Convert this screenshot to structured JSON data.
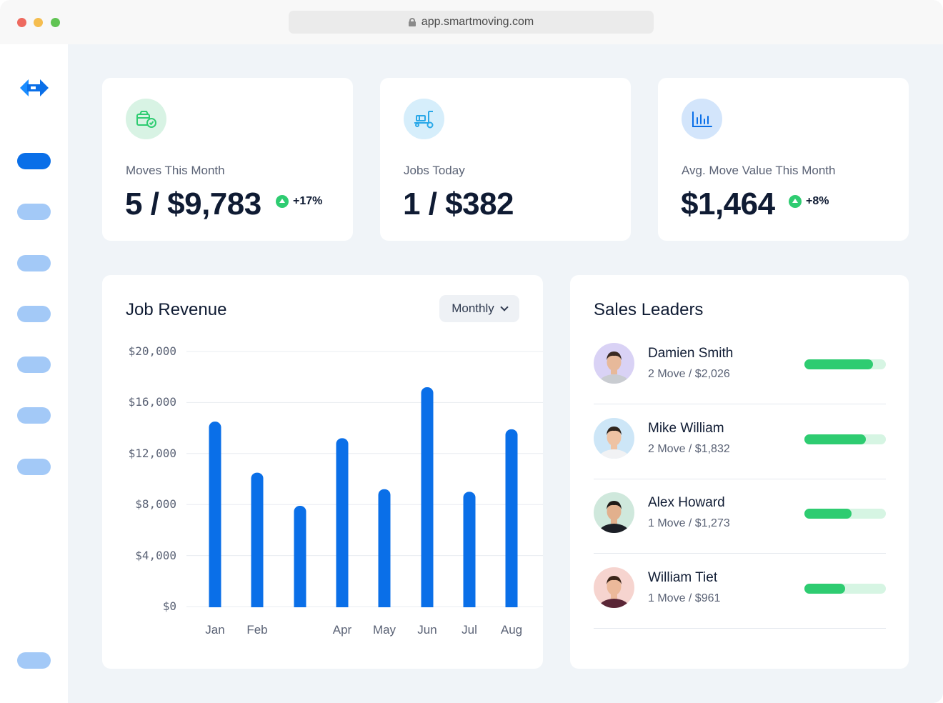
{
  "browser": {
    "url": "app.smartmoving.com"
  },
  "colors": {
    "accent": "#0a6fe8",
    "nav_inactive": "#a3c9f7",
    "success": "#2ecc71",
    "success_track": "#d6f5e3",
    "background": "#f0f4f8"
  },
  "sidebar": {
    "logo": "smartmoving-logo",
    "items": [
      {
        "icon": "nav-item",
        "active": true
      },
      {
        "icon": "nav-item",
        "active": false
      },
      {
        "icon": "nav-item",
        "active": false
      },
      {
        "icon": "nav-item",
        "active": false
      },
      {
        "icon": "nav-item",
        "active": false
      },
      {
        "icon": "nav-item",
        "active": false
      },
      {
        "icon": "nav-item",
        "active": false
      },
      {
        "icon": "nav-item",
        "active": false
      }
    ]
  },
  "stats": [
    {
      "icon": "box-check-icon",
      "label": "Moves This Month",
      "value": "5 / $9,783",
      "delta": "+17%"
    },
    {
      "icon": "dolly-icon",
      "label": "Jobs Today",
      "value": "1 / $382",
      "delta": ""
    },
    {
      "icon": "bar-chart-icon",
      "label": "Avg. Move Value This Month",
      "value": "$1,464",
      "delta": "+8%"
    }
  ],
  "revenue": {
    "title": "Job Revenue",
    "period": "Monthly"
  },
  "chart_data": {
    "type": "bar",
    "title": "Job Revenue",
    "categories": [
      "Jan",
      "Feb",
      "",
      "Apr",
      "May",
      "Jun",
      "Jul",
      "Aug"
    ],
    "values": [
      14500,
      10500,
      7900,
      13200,
      9200,
      17200,
      9000,
      13900
    ],
    "ylim": [
      0,
      20000
    ],
    "yticks": [
      "$20,000",
      "$16,000",
      "$12,000",
      "$8,000",
      "$4,000",
      "$0"
    ],
    "ytick_values": [
      20000,
      16000,
      12000,
      8000,
      4000,
      0
    ],
    "grid": true,
    "color": "#0a6fe8"
  },
  "leaders": {
    "title": "Sales Leaders",
    "items": [
      {
        "name": "Damien Smith",
        "detail": "2 Move / $2,026",
        "progress": 0.84,
        "avatar_bg": "#d9d2f5",
        "skin": "#e7b99a",
        "hair": "#3a2a22",
        "shirt": "#c9ccd1"
      },
      {
        "name": "Mike William",
        "detail": "2 Move / $1,832",
        "progress": 0.75,
        "avatar_bg": "#cde6f7",
        "skin": "#eec3a4",
        "hair": "#2e241d",
        "shirt": "#f1f2f4"
      },
      {
        "name": "Alex Howard",
        "detail": "1 Move / $1,273",
        "progress": 0.58,
        "avatar_bg": "#cfe8dc",
        "skin": "#e2b08d",
        "hair": "#1f1a17",
        "shirt": "#1c1f26"
      },
      {
        "name": "William Tiet",
        "detail": "1 Move / $961",
        "progress": 0.5,
        "avatar_bg": "#f6d4cf",
        "skin": "#ebb99a",
        "hair": "#3b2519",
        "shirt": "#5a2636"
      }
    ]
  }
}
